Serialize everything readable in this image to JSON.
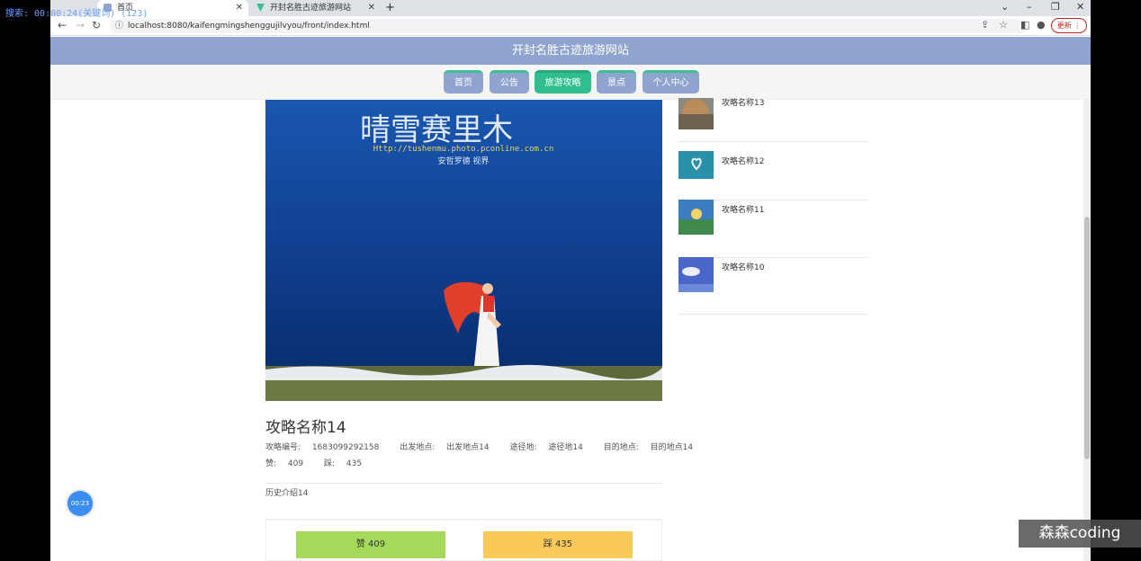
{
  "overlay": {
    "search_text": "搜索: 00:00:24(关键词) (123)"
  },
  "browser": {
    "tabs": [
      {
        "label": "首页",
        "active": true
      },
      {
        "label": "开封名胜古迹旅游网站",
        "active": false
      }
    ],
    "new_tab": "+",
    "url": "localhost:8080/kaifengmingshenggujilvyou/front/index.html",
    "update_label": "更新"
  },
  "site": {
    "title": "开封名胜古迹旅游网站",
    "nav": [
      {
        "label": "首页",
        "active": false
      },
      {
        "label": "公告",
        "active": false
      },
      {
        "label": "旅游攻略",
        "active": true
      },
      {
        "label": "景点",
        "active": false
      },
      {
        "label": "个人中心",
        "active": false
      }
    ]
  },
  "detail": {
    "title": "攻略名称14",
    "code_label": "攻略编号:",
    "code": "1683099292158",
    "departure_label": "出发地点:",
    "departure": "出发地点14",
    "via_label": "途径地:",
    "via": "途径地14",
    "destination_label": "目的地点:",
    "destination": "目的地点14",
    "like_label": "赞:",
    "like_count": "409",
    "dislike_label": "踩:",
    "dislike_count": "435",
    "history": "历史介绍14",
    "like_button": "赞  409",
    "dislike_button": "踩  435",
    "image_watermark": {
      "brand": "晴雪赛里木",
      "url": "Http://tushenmu.photo.pconline.com.cn",
      "author": "安哲罗德  视界"
    }
  },
  "sidebar": [
    {
      "label": "攻略名称13"
    },
    {
      "label": "攻略名称12"
    },
    {
      "label": "攻略名称11"
    },
    {
      "label": "攻略名称10"
    }
  ],
  "timer": "00:23",
  "watermark": "森森coding",
  "colors": {
    "header": "#8fa4cf",
    "nav_active": "#2fbf8f",
    "like": "#a5d95a",
    "dislike": "#fbc85a"
  }
}
